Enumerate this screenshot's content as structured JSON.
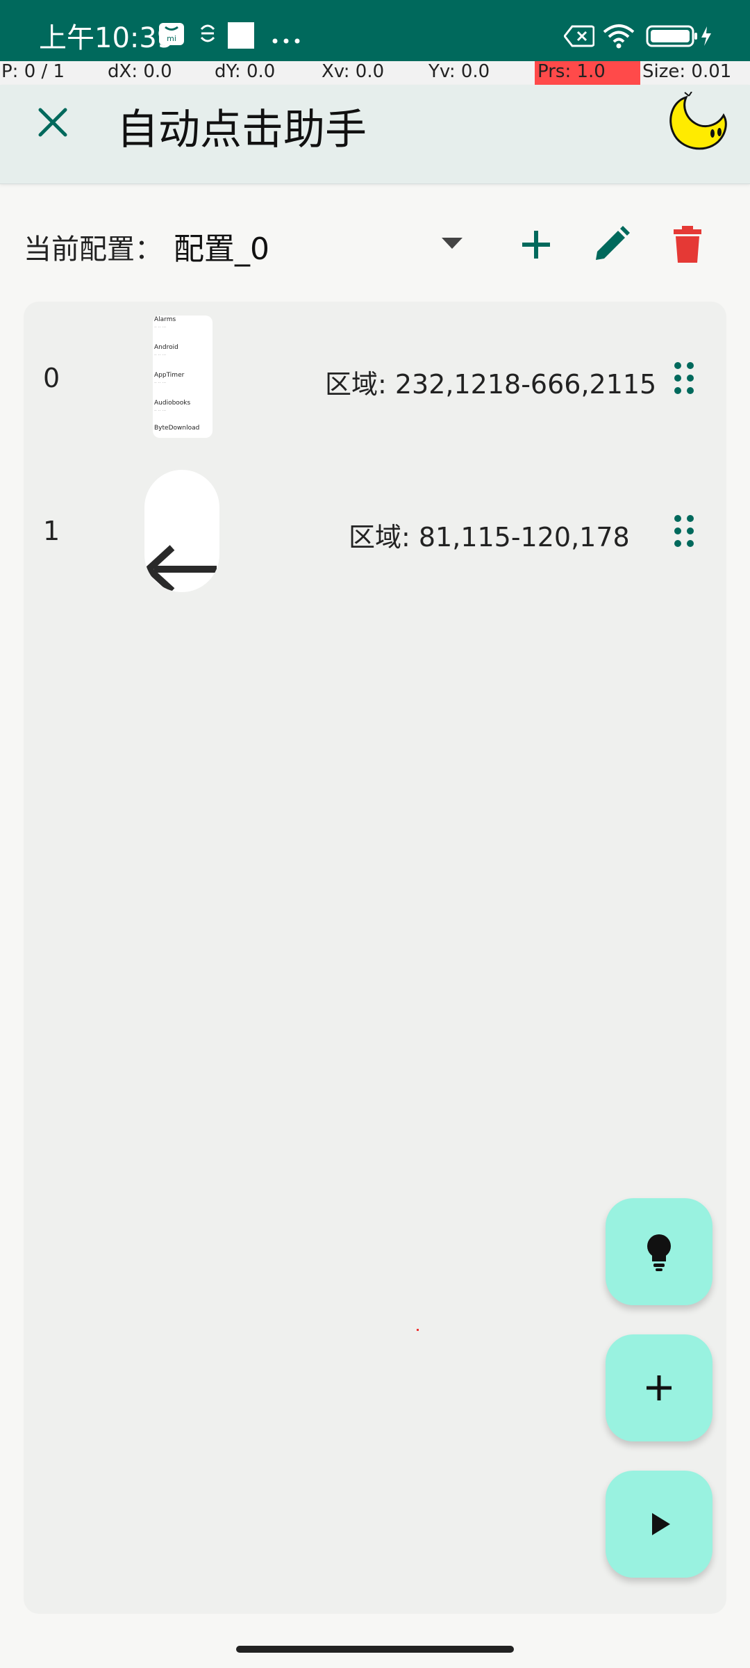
{
  "status_bar": {
    "time": "上午10:39",
    "icons": [
      "mi-store-icon",
      "sync-icon",
      "white-square-icon",
      "more-icon",
      "battery-saver-icon",
      "wifi-icon",
      "battery-charging-icon"
    ]
  },
  "debug": {
    "p": "P: 0 / 1",
    "dx": "dX: 0.0",
    "dy": "dY: 0.0",
    "xv": "Xv: 0.0",
    "yv": "Yv: 0.0",
    "prs": "Prs: 1.0",
    "size": "Size: 0.01"
  },
  "header": {
    "title": "自动点击助手"
  },
  "config": {
    "label": "当前配置：",
    "selected": "配置_0"
  },
  "rows": [
    {
      "index": "0",
      "region": "区域: 232,1218-666,2115",
      "thumb_lines": [
        "Alarms",
        "Android",
        "AppTimer",
        "Audiobooks",
        "ByteDownload"
      ]
    },
    {
      "index": "1",
      "region": "区域: 81,115-120,178"
    }
  ],
  "colors": {
    "primary": "#00695c",
    "accent": "#99f2e0",
    "delete": "#e53935"
  }
}
